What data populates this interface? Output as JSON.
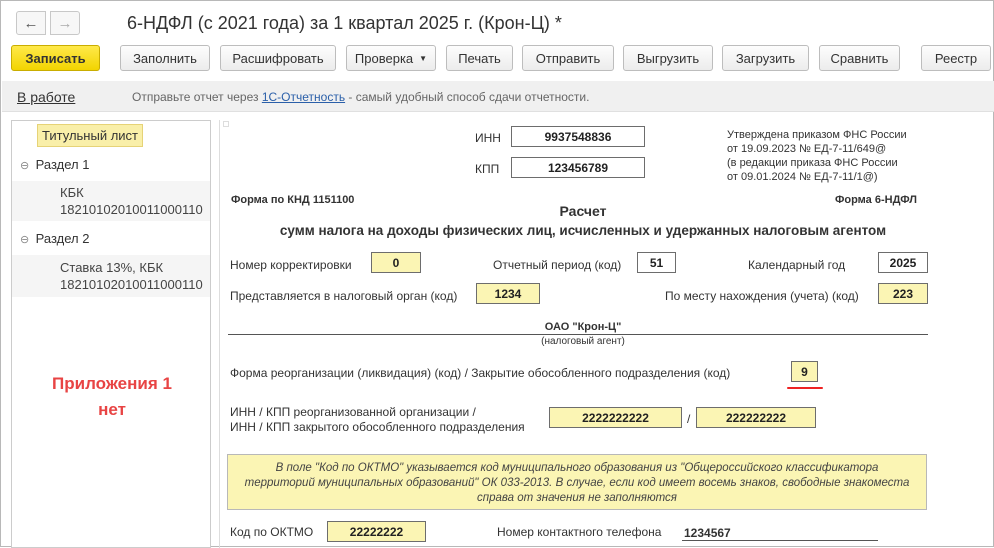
{
  "window": {
    "title": "6-НДФЛ (с 2021 года) за 1 квартал 2025 г. (Крон-Ц) *",
    "nav": {
      "back_icon": "arrow-left-icon",
      "forward_icon": "arrow-right-icon"
    }
  },
  "toolbar": {
    "save": "Записать",
    "fill": "Заполнить",
    "decode": "Расшифровать",
    "check": "Проверка",
    "print": "Печать",
    "send": "Отправить",
    "export": "Выгрузить",
    "import": "Загрузить",
    "compare": "Сравнить",
    "registry": "Реестр"
  },
  "infobar": {
    "status": "В работе",
    "text_before": "Отправьте отчет через ",
    "link": "1С-Отчетность",
    "text_after": " - самый удобный способ сдачи отчетности."
  },
  "sidebar": {
    "title_page": "Титульный лист",
    "section1": "Раздел 1",
    "section1_sub_label": "КБК",
    "section1_sub_value": "18210102010011000110",
    "section2": "Раздел 2",
    "section2_sub_label": "Ставка 13%, КБК",
    "section2_sub_value": "18210102010011000110",
    "appendix_line1": "Приложения 1",
    "appendix_line2": "нет"
  },
  "form": {
    "inn_label": "ИНН",
    "inn_value": "9937548836",
    "kpp_label": "КПП",
    "kpp_value": "123456789",
    "approval": [
      "Утверждена приказом ФНС России",
      "от 19.09.2023 № ЕД-7-11/649@",
      "(в редакции приказа ФНС России",
      "от 09.01.2024 № ЕД-7-11/1@)"
    ],
    "knd": "Форма по КНД 1151100",
    "form_name": "Форма 6-НДФЛ",
    "heading1": "Расчет",
    "heading2": "сумм налога на доходы физических лиц, исчисленных и удержанных налоговым агентом",
    "correction_label": "Номер корректировки",
    "correction_value": "0",
    "period_label": "Отчетный период (код)",
    "period_value": "51",
    "year_label": "Календарный год",
    "year_value": "2025",
    "tax_office_label": "Представляется в налоговый орган (код)",
    "tax_office_value": "1234",
    "location_label": "По месту нахождения (учета) (код)",
    "location_value": "223",
    "agent_name": "ОАО \"Крон-Ц\"",
    "agent_caption": "(налоговый агент)",
    "reorg_label": "Форма реорганизации (ликвидация) (код) / Закрытие обособленного подразделения (код)",
    "reorg_value": "9",
    "reorg_inn_label1": "ИНН / КПП реорганизованной организации /",
    "reorg_inn_label2": "ИНН / КПП закрытого обособленного подразделения",
    "reorg_inn_value": "2222222222",
    "slash": "/",
    "reorg_kpp_value": "222222222",
    "note": "В поле \"Код по ОКТМО\" указывается код муниципального образования из \"Общероссийского классификатора территорий муниципальных образований\" ОК 033-2013. В случае, если код имеет восемь знаков, свободные знакоместа справа от значения не заполняются",
    "oktmo_label": "Код по ОКТМО",
    "oktmo_value": "22222222",
    "phone_label": "Номер контактного телефона",
    "phone_value": "1234567"
  },
  "colors": {
    "primary_button": "#f2d400",
    "yellow_field": "#fbf5b4",
    "selected_tree": "#f9efa9",
    "appendix_text": "#e84444",
    "link": "#2a5fa9",
    "red_underline": "#e22222"
  }
}
